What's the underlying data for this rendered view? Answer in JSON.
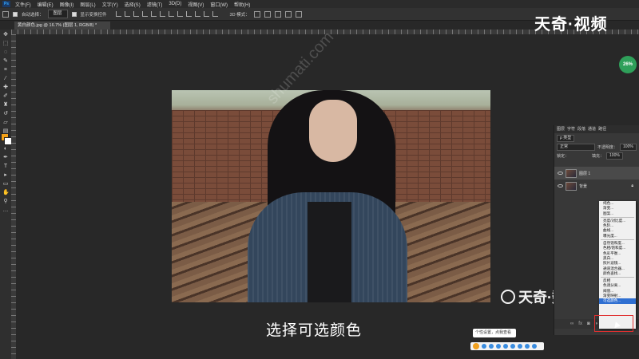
{
  "menubar": {
    "items": [
      "文件(F)",
      "编辑(E)",
      "图像(I)",
      "图层(L)",
      "文字(Y)",
      "选择(S)",
      "滤镜(T)",
      "3D(D)",
      "视图(V)",
      "窗口(W)",
      "帮助(H)"
    ]
  },
  "optionsbar": {
    "auto_select_label": "自动选择：",
    "auto_select_value": "图层",
    "show_transform_label": "显示变换控件",
    "mode_3d_label": "3D 模式："
  },
  "document_tab": {
    "title": "黄白颜色.jpg @ 16.7% (图层 1, RGB/8) *"
  },
  "watermark": {
    "diagonal": "shumati.com",
    "brand_top": "天奇·视频",
    "brand_bottom": "天奇·数码"
  },
  "subtitle": "选择可选颜色",
  "zoom_badge": "26%",
  "layers_panel": {
    "tabs": [
      "图层",
      "字符",
      "段落",
      "通道",
      "路径"
    ],
    "filter_label": "ρ 类型",
    "blend_mode": "正常",
    "opacity_label": "不透明度：",
    "opacity_value": "100%",
    "lock_label": "锁定：",
    "fill_label": "填充：",
    "fill_value": "100%",
    "layers": [
      {
        "name": "图层 1"
      },
      {
        "name": "背景"
      }
    ],
    "footer_icons": [
      "link-icon",
      "fx-icon",
      "mask-icon",
      "adjustment-icon",
      "folder-icon",
      "new-layer-icon",
      "trash-icon"
    ]
  },
  "context_menu": {
    "groups": [
      [
        "纯色...",
        "渐变...",
        "图案..."
      ],
      [
        "亮度/对比度...",
        "色阶...",
        "曲线...",
        "曝光度..."
      ],
      [
        "自然饱和度...",
        "色相/饱和度...",
        "色彩平衡...",
        "黑白...",
        "照片滤镜...",
        "通道混合器...",
        "颜色查找..."
      ],
      [
        "反相",
        "色调分离...",
        "阈值...",
        "渐变映射...",
        "可选颜色..."
      ]
    ],
    "highlighted": "可选颜色..."
  },
  "tooltip": {
    "text": "个性设置，点我查看"
  },
  "colors": {
    "foreground": "#f4a117",
    "background": "#ffffff",
    "highlight": "#2f6fd1",
    "annotation": "#e03030"
  }
}
